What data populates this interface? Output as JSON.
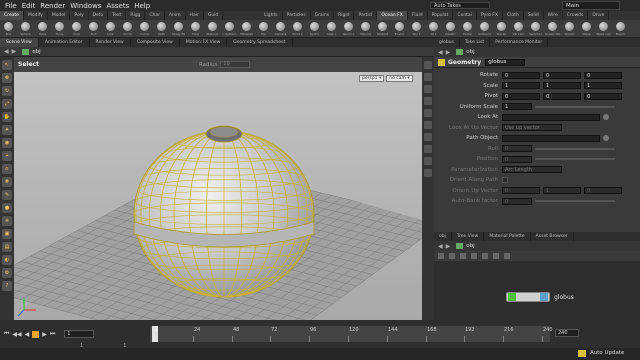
{
  "menubar": {
    "items": [
      "File",
      "Edit",
      "Render",
      "Windows",
      "Assets",
      "Help"
    ],
    "take_label": "Auto Takes",
    "desktop": "Main"
  },
  "shelf_tabs_left": [
    "Create",
    "Modify",
    "Model",
    "Poly",
    "Defo",
    "Text",
    "Rigg",
    "Char",
    "Anim",
    "Hair",
    "Guid"
  ],
  "shelf_tabs_right": [
    "Lights",
    "Particles",
    "Grains",
    "Rigid",
    "Particl",
    "Ocean FX",
    "Fluid",
    "Populat",
    "Contai",
    "Pyro FX",
    "Cloth",
    "Solid",
    "Wire",
    "Crowds",
    "Drive"
  ],
  "shelf_tools": [
    "Box",
    "Sphere",
    "Tube",
    "Torus",
    "Grid",
    "Null",
    "Line",
    "Circle",
    "Curve",
    "Path",
    "Spray Pa",
    "Font",
    "Platonic",
    "L-System",
    "Metaball",
    "File",
    "Camera",
    "Point L",
    "Spot L",
    "Area L",
    "Geom L",
    "Volume",
    "Distant",
    "Enviro",
    "Sky L",
    "GI L",
    "Caustic",
    "Portal",
    "Ambient",
    "Stereo",
    "VR Cam",
    "Switcher",
    "Ocean Wa",
    "Splash",
    "Wave",
    "Wave Lay",
    "Beach",
    "Flat Tank",
    "Wave Tank"
  ],
  "pane_tabs": [
    "Scene View",
    "Animation Editor",
    "Render View",
    "Composite View",
    "Motion FX View",
    "Geometry Spreadsheet"
  ],
  "viewport": {
    "path": "obj",
    "tool": "Select",
    "radius_label": "Radius",
    "radius_value": "10",
    "persp": "persp1 ▾",
    "cam": "no cam ▾"
  },
  "right_tabs": [
    "globus",
    "Take List",
    "Performance Monitor"
  ],
  "params": {
    "node_type": "Geometry",
    "node_name": "globus",
    "rows": [
      {
        "label": "Rotate",
        "v": [
          "0",
          "0",
          "0"
        ],
        "dim": false
      },
      {
        "label": "Scale",
        "v": [
          "1",
          "1",
          "1"
        ],
        "dim": false
      },
      {
        "label": "Pivot",
        "v": [
          "0",
          "0",
          "0"
        ],
        "dim": false
      },
      {
        "label": "Uniform Scale",
        "v": [
          "1"
        ],
        "dim": false
      },
      {
        "label": "Look At",
        "v": [
          ""
        ],
        "dim": false
      },
      {
        "label": "Look At Up Vector",
        "v": [
          "Use up vector"
        ],
        "dim": true
      },
      {
        "label": "Path Object",
        "v": [
          ""
        ],
        "dim": false
      },
      {
        "label": "Roll",
        "v": [
          "0"
        ],
        "dim": true
      },
      {
        "label": "Position",
        "v": [
          "0"
        ],
        "dim": true
      },
      {
        "label": "Parameterization",
        "v": [
          "Arc Length"
        ],
        "dim": true
      },
      {
        "label": "Orient Along Path",
        "v": [
          ""
        ],
        "dim": true
      },
      {
        "label": "Orient Up Vector",
        "v": [
          "0",
          "1",
          "0"
        ],
        "dim": true
      },
      {
        "label": "Auto-Bank factor",
        "v": [
          "0"
        ],
        "dim": true
      }
    ]
  },
  "network": {
    "tabs": [
      "obj",
      "Tree View",
      "Material Palette",
      "Asset Browser"
    ],
    "path": "obj",
    "node_label": "globus"
  },
  "timeline": {
    "ticks": [
      "1",
      "24",
      "48",
      "72",
      "96",
      "120",
      "144",
      "168",
      "192",
      "216",
      "240"
    ],
    "current_frame": "1",
    "start": "1",
    "end": "1",
    "range_end": "240",
    "end_field": "240"
  },
  "status": {
    "auto_update": "Auto Update"
  }
}
